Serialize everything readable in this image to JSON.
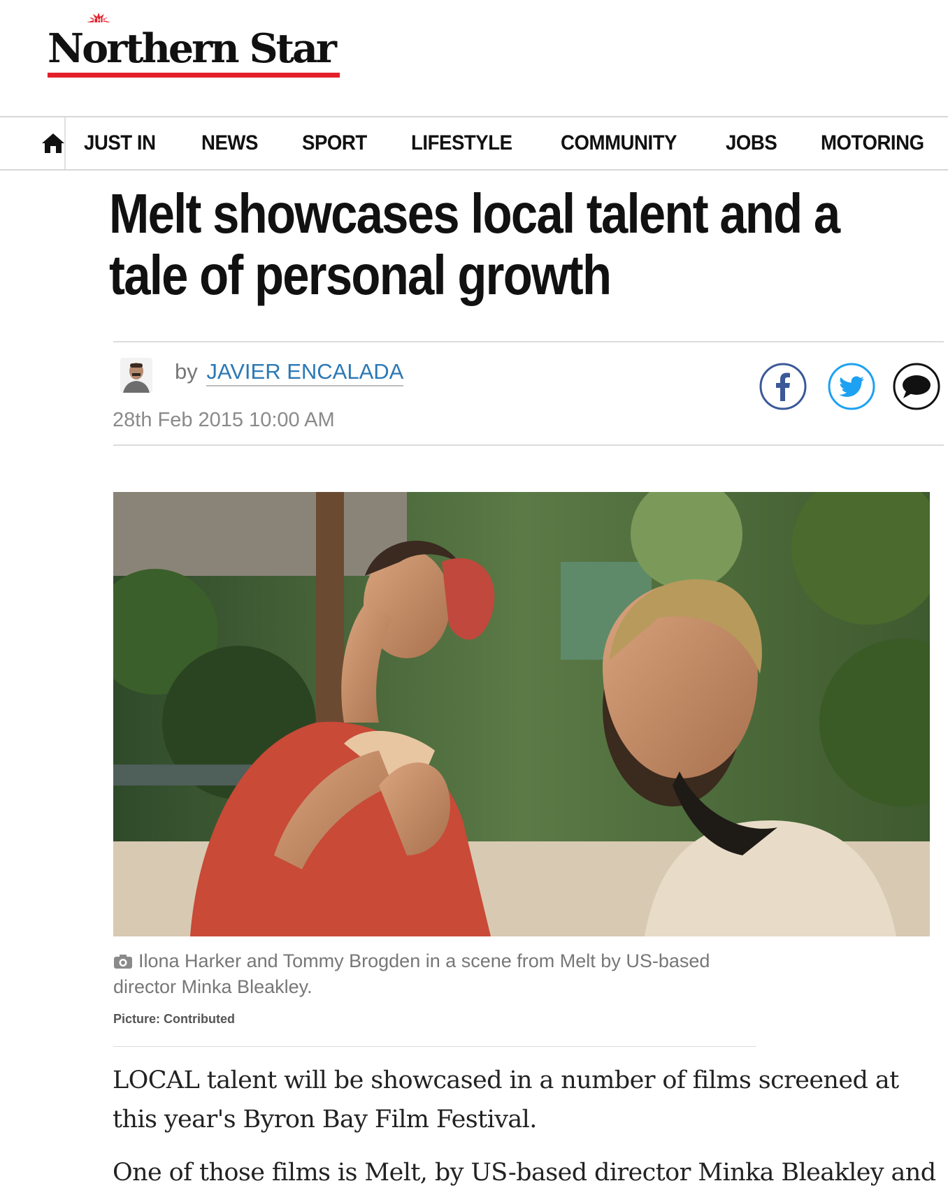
{
  "brand": {
    "the_label": "THE",
    "name": "Northern Star",
    "accent_color": "#e3202a"
  },
  "nav": {
    "home_icon": "home-icon",
    "items": [
      "JUST IN",
      "NEWS",
      "SPORT",
      "LIFESTYLE",
      "COMMUNITY",
      "JOBS",
      "MOTORING"
    ]
  },
  "article": {
    "headline_line1": "Melt showcases local talent and a",
    "headline_line2": "tale of personal growth",
    "byline_prefix": "by",
    "author": "JAVIER ENCALADA",
    "date": "28th Feb 2015 10:00 AM",
    "share": {
      "facebook_icon": "facebook-icon",
      "twitter_icon": "twitter-icon",
      "comment_icon": "comment-icon"
    },
    "photo_caption": "Ilona Harker and Tommy Brogden in a scene from Melt by US-based director Minka Bleakley.",
    "photo_credit": "Picture: Contributed",
    "paragraph1": "LOCAL talent will be showcased in a number of films screened at this year's Byron Bay Film Festival.",
    "paragraph2": "One of those films is Melt, by US-based director Minka Bleakley and"
  }
}
